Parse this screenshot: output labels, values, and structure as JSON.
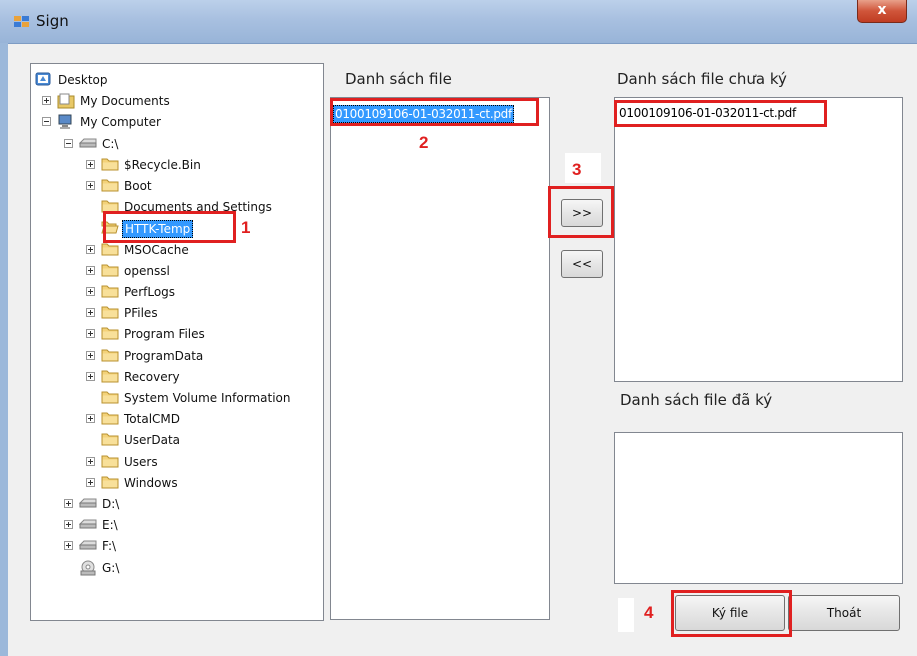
{
  "window": {
    "title": "Sign",
    "close_label": "x"
  },
  "tree": [
    {
      "id": "desktop",
      "label": "Desktop",
      "expander": "none",
      "icon": "desktop-icon"
    },
    {
      "id": "mydocs",
      "label": "My Documents",
      "expander": "plus",
      "icon": "documents-icon"
    },
    {
      "id": "mycomputer",
      "label": "My Computer",
      "expander": "minus",
      "icon": "computer-icon"
    },
    {
      "id": "c",
      "label": "C:\\",
      "expander": "minus",
      "icon": "drive-icon"
    },
    {
      "id": "recycle",
      "label": "$Recycle.Bin",
      "expander": "plus",
      "icon": "folder-icon"
    },
    {
      "id": "boot",
      "label": "Boot",
      "expander": "plus",
      "icon": "folder-icon"
    },
    {
      "id": "docsettings",
      "label": "Documents and Settings",
      "expander": "none",
      "icon": "folder-icon"
    },
    {
      "id": "httk",
      "label": "HTTK-Temp",
      "expander": "none",
      "icon": "folder-open-icon",
      "selected": true
    },
    {
      "id": "msocache",
      "label": "MSOCache",
      "expander": "plus",
      "icon": "folder-icon"
    },
    {
      "id": "openssl",
      "label": "openssl",
      "expander": "plus",
      "icon": "folder-icon"
    },
    {
      "id": "perflogs",
      "label": "PerfLogs",
      "expander": "plus",
      "icon": "folder-icon"
    },
    {
      "id": "pfiles",
      "label": "PFiles",
      "expander": "plus",
      "icon": "folder-icon"
    },
    {
      "id": "progfiles",
      "label": "Program Files",
      "expander": "plus",
      "icon": "folder-icon"
    },
    {
      "id": "progdata",
      "label": "ProgramData",
      "expander": "plus",
      "icon": "folder-icon"
    },
    {
      "id": "recovery",
      "label": "Recovery",
      "expander": "plus",
      "icon": "folder-icon"
    },
    {
      "id": "svi",
      "label": "System Volume Information",
      "expander": "none",
      "icon": "folder-icon"
    },
    {
      "id": "totalcmd",
      "label": "TotalCMD",
      "expander": "plus",
      "icon": "folder-icon"
    },
    {
      "id": "userdata",
      "label": "UserData",
      "expander": "none",
      "icon": "folder-icon"
    },
    {
      "id": "users",
      "label": "Users",
      "expander": "plus",
      "icon": "folder-icon"
    },
    {
      "id": "windows",
      "label": "Windows",
      "expander": "plus",
      "icon": "folder-icon"
    },
    {
      "id": "d",
      "label": "D:\\",
      "expander": "plus",
      "icon": "drive-icon"
    },
    {
      "id": "e",
      "label": "E:\\",
      "expander": "plus",
      "icon": "drive-icon"
    },
    {
      "id": "f",
      "label": "F:\\",
      "expander": "plus",
      "icon": "drive-icon"
    },
    {
      "id": "g",
      "label": "G:\\",
      "expander": "none",
      "icon": "cd-drive-icon"
    }
  ],
  "file_list": {
    "label": "Danh sách file",
    "items": [
      "0100109106-01-032011-ct.pdf"
    ]
  },
  "unsigned_list": {
    "label": "Danh sách file chưa ký",
    "items": [
      "0100109106-01-032011-ct.pdf"
    ]
  },
  "signed_list": {
    "label": "Danh sách file đã ký",
    "items": []
  },
  "buttons": {
    "move_right": ">>",
    "move_left": "<<",
    "sign": "Ký file",
    "exit": "Thoát"
  },
  "annotations": {
    "step1": "1",
    "step2": "2",
    "step3": "3",
    "step4": "4"
  },
  "colors": {
    "selection": "#3399ff",
    "annotation": "#e02020"
  }
}
